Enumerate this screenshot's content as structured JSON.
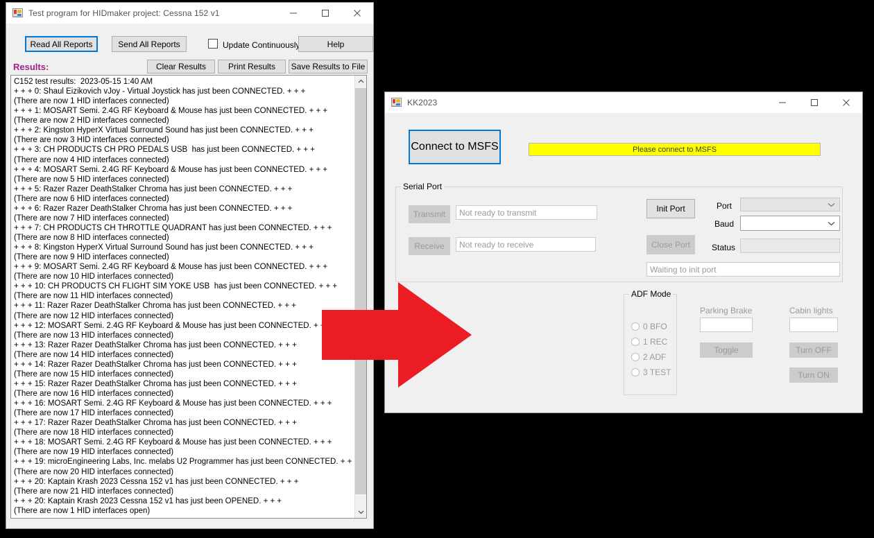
{
  "hid_window": {
    "title": "Test program for HIDmaker project: Cessna 152 v1",
    "icon": "winforms-app-icon",
    "minimize": "—",
    "maximize": "☐",
    "close": "✕",
    "toolbar": {
      "read_all_reports": "Read All Reports",
      "send_all_reports": "Send All Reports",
      "update_continuously": "Update Continuously",
      "help": "Help"
    },
    "results_label": "Results:",
    "results_label_color": "#a0208c",
    "results_buttons": {
      "clear_results": "Clear Results",
      "print_results": "Print Results",
      "save_results_to_file": "Save Results to File"
    },
    "results_log": "C152 test results:  2023-05-15 1:40 AM\n+ + + 0: Shaul Eizikovich vJoy - Virtual Joystick has just been CONNECTED. + + +\n(There are now 1 HID interfaces connected)\n+ + + 1: MOSART Semi. 2.4G RF Keyboard & Mouse has just been CONNECTED. + + +\n(There are now 2 HID interfaces connected)\n+ + + 2: Kingston HyperX Virtual Surround Sound has just been CONNECTED. + + +\n(There are now 3 HID interfaces connected)\n+ + + 3: CH PRODUCTS CH PRO PEDALS USB  has just been CONNECTED. + + +\n(There are now 4 HID interfaces connected)\n+ + + 4: MOSART Semi. 2.4G RF Keyboard & Mouse has just been CONNECTED. + + +\n(There are now 5 HID interfaces connected)\n+ + + 5: Razer Razer DeathStalker Chroma has just been CONNECTED. + + +\n(There are now 6 HID interfaces connected)\n+ + + 6: Razer Razer DeathStalker Chroma has just been CONNECTED. + + +\n(There are now 7 HID interfaces connected)\n+ + + 7: CH PRODUCTS CH THROTTLE QUADRANT has just been CONNECTED. + + +\n(There are now 8 HID interfaces connected)\n+ + + 8: Kingston HyperX Virtual Surround Sound has just been CONNECTED. + + +\n(There are now 9 HID interfaces connected)\n+ + + 9: MOSART Semi. 2.4G RF Keyboard & Mouse has just been CONNECTED. + + +\n(There are now 10 HID interfaces connected)\n+ + + 10: CH PRODUCTS CH FLIGHT SIM YOKE USB  has just been CONNECTED. + + +\n(There are now 11 HID interfaces connected)\n+ + + 11: Razer Razer DeathStalker Chroma has just been CONNECTED. + + +\n(There are now 12 HID interfaces connected)\n+ + + 12: MOSART Semi. 2.4G RF Keyboard & Mouse has just been CONNECTED. + + +\n(There are now 13 HID interfaces connected)\n+ + + 13: Razer Razer DeathStalker Chroma has just been CONNECTED. + + +\n(There are now 14 HID interfaces connected)\n+ + + 14: Razer Razer DeathStalker Chroma has just been CONNECTED. + + +\n(There are now 15 HID interfaces connected)\n+ + + 15: Razer Razer DeathStalker Chroma has just been CONNECTED. + + +\n(There are now 16 HID interfaces connected)\n+ + + 16: MOSART Semi. 2.4G RF Keyboard & Mouse has just been CONNECTED. + + +\n(There are now 17 HID interfaces connected)\n+ + + 17: Razer Razer DeathStalker Chroma has just been CONNECTED. + + +\n(There are now 18 HID interfaces connected)\n+ + + 18: MOSART Semi. 2.4G RF Keyboard & Mouse has just been CONNECTED. + + +\n(There are now 19 HID interfaces connected)\n+ + + 19: microEngineering Labs, Inc. melabs U2 Programmer has just been CONNECTED. + + +\n(There are now 20 HID interfaces connected)\n+ + + 20: Kaptain Krash 2023 Cessna 152 v1 has just been CONNECTED. + + +\n(There are now 21 HID interfaces connected)\n+ + + 20: Kaptain Krash 2023 Cessna 152 v1 has just been OPENED. + + +\n(There are now 1 HID interfaces open)"
  },
  "kk_window": {
    "title": "KK2023",
    "icon": "winforms-app-icon",
    "minimize": "—",
    "maximize": "☐",
    "close": "✕",
    "connect_button": "Connect to MSFS",
    "status_banner": {
      "text": "Please connect to MSFS",
      "background": "#ffff00"
    },
    "serial_port": {
      "title": "Serial Port",
      "transmit_button": "Transmit",
      "transmit_value": "Not ready to transmit",
      "receive_button": "Receive",
      "receive_value": "Not ready to receive",
      "init_port_button": "Init Port",
      "close_port_button": "Close Port",
      "port_label": "Port",
      "port_value": "",
      "baud_label": "Baud",
      "baud_value": "",
      "status_label": "Status",
      "status_value": "",
      "port_state_value": "Waiting to init port"
    },
    "adf_mode": {
      "title": "ADF Mode",
      "options": [
        {
          "label": "0 BFO",
          "selected": false
        },
        {
          "label": "1 REC",
          "selected": false
        },
        {
          "label": "2 ADF",
          "selected": false
        },
        {
          "label": "3 TEST",
          "selected": false
        }
      ]
    },
    "parking_brake": {
      "label": "Parking Brake",
      "value": "",
      "toggle_button": "Toggle"
    },
    "cabin_lights": {
      "label": "Cabin lights",
      "value": "",
      "turn_off_button": "Turn OFF",
      "turn_on_button": "Turn ON"
    }
  },
  "annotation": {
    "arrow": "red-right-arrow",
    "arrow_color": "#eb1c24"
  }
}
